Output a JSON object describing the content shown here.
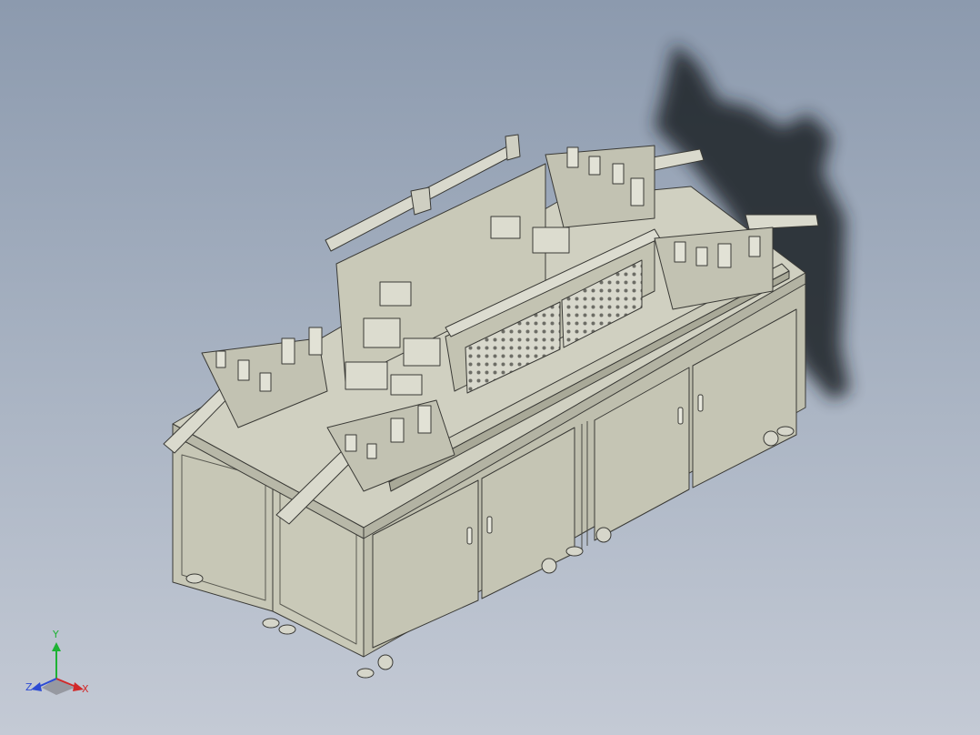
{
  "viewport": {
    "background_top": "#8c9aae",
    "background_bottom": "#c4cad5",
    "model_color": "#c9c9b9",
    "edge_color": "#3a3a36",
    "shadow_color": "#1e2128"
  },
  "triad": {
    "x_label": "X",
    "y_label": "Y",
    "z_label": "Z",
    "x_color": "#d12a2a",
    "y_color": "#1db233",
    "z_color": "#2c4bd4"
  }
}
